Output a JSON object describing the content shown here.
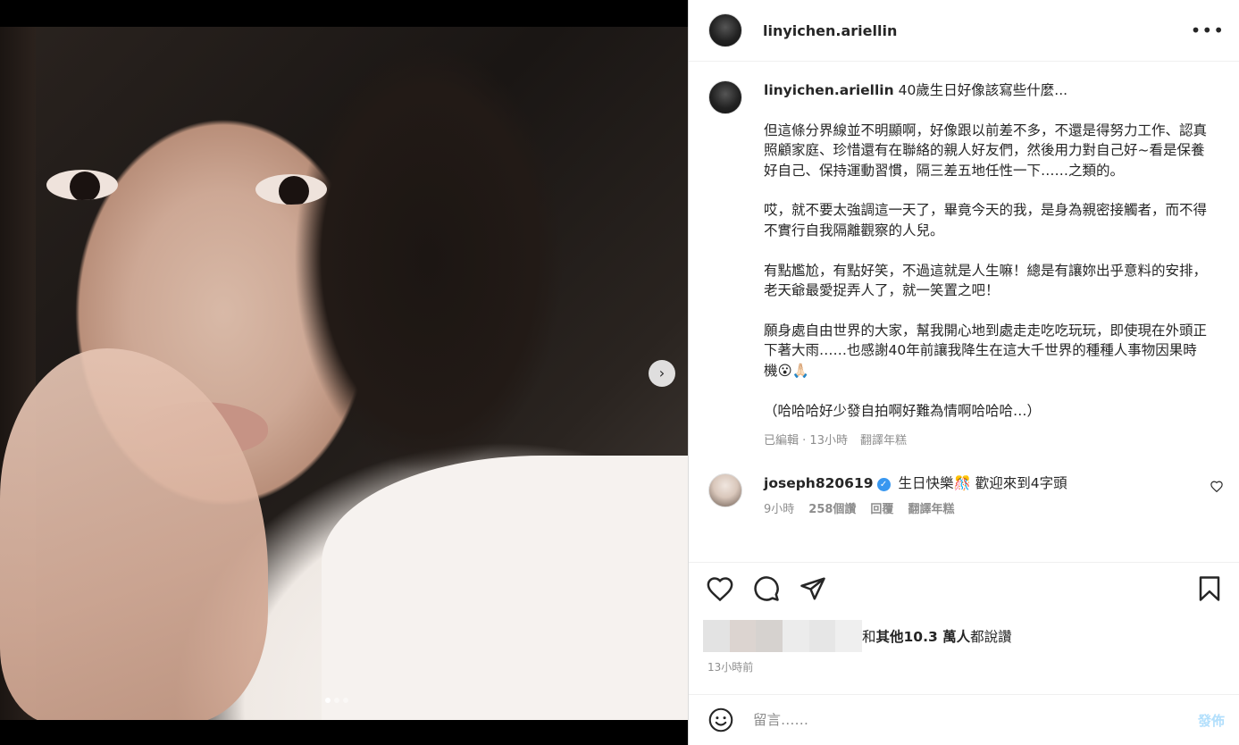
{
  "post": {
    "author": "linyichen.ariellin",
    "caption_lead": "40歲生日好像該寫些什麼...",
    "caption_paragraphs": [
      "但這條分界線並不明顯啊，好像跟以前差不多，不還是得努力工作、認真照顧家庭、珍惜還有在聯絡的親人好友們，然後用力對自己好~看是保養好自己、保持運動習慣，隔三差五地任性一下……之類的。",
      "哎，就不要太強調這一天了，畢竟今天的我，是身為親密接觸者，而不得不實行自我隔離觀察的人兒。",
      "有點尷尬，有點好笑，不過這就是人生嘛！總是有讓妳出乎意料的安排，老天爺最愛捉弄人了，就一笑置之吧！",
      "願身處自由世界的大家，幫我開心地到處走走吃吃玩玩，即使現在外頭正下著大雨……也感謝40年前讓我降生在這大千世界的種種人事物因果時機😮🙏🏻",
      "（哈哈哈好少發自拍啊好難為情啊哈哈哈…）"
    ],
    "caption_edited": "已編輯",
    "caption_time": "13小時",
    "caption_translate": "翻譯年糕"
  },
  "reply": {
    "username": "joseph820619",
    "verified_mark": "✓",
    "text": "生日快樂🎊 歡迎來到4字頭",
    "time": "9小時",
    "likes": "258個讚",
    "reply_label": "回覆",
    "translate_label": "翻譯年糕"
  },
  "likes": {
    "prefix": "和",
    "others": "其他10.3 萬人",
    "suffix": "都說讚",
    "blur_colors": [
      "#e3e3e3",
      "#dcd4d0",
      "#d6d2cf",
      "#ececec",
      "#e6e6e6",
      "#efefef"
    ]
  },
  "time_ago": "13小時前",
  "comment_box": {
    "placeholder": "留言……",
    "post_label": "發佈"
  },
  "media": {
    "next_glyph": "›",
    "slide_count": 3,
    "active_slide": 1
  },
  "more_glyph": "•••"
}
